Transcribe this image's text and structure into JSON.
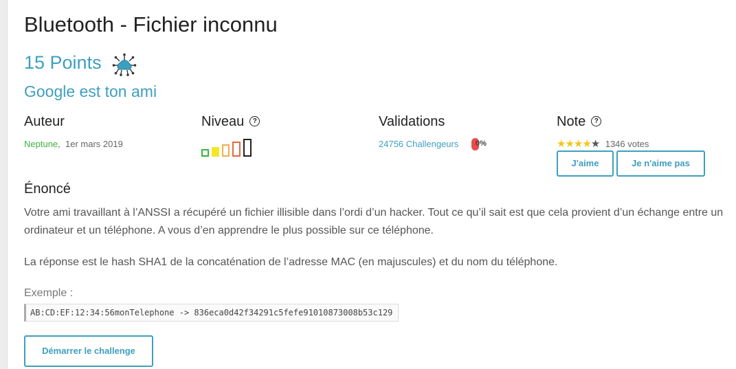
{
  "challenge": {
    "title": "Bluetooth - Fichier inconnu",
    "points": "15 Points",
    "category_icon": "network-cloud-icon",
    "hint": "Google est ton ami"
  },
  "author": {
    "heading": "Auteur",
    "name": "Neptune",
    "separator": ",",
    "date": "1er mars 2019"
  },
  "level": {
    "heading": "Niveau",
    "help_glyph": "?",
    "current": 1,
    "max": 5,
    "colors": [
      "#3bb33b",
      "#f5e625",
      "#f0ad4e",
      "#e8663c",
      "#222222"
    ]
  },
  "validations": {
    "heading": "Validations",
    "count": "24756 Challengeurs",
    "percent_text": "0%",
    "badge_color": "#e84c4c"
  },
  "rating": {
    "heading": "Note",
    "help_glyph": "?",
    "stars": 4,
    "max_stars": 5,
    "votes": "1346 votes",
    "like": "J'aime",
    "dislike": "Je n'aime pas"
  },
  "statement": {
    "heading": "Énoncé",
    "para1": "Votre ami travaillant à l’ANSSI a récupéré un fichier illisible dans l’ordi d’un hacker. Tout ce qu’il sait est que cela provient d’un échange entre un ordinateur et un téléphone. A vous d’en apprendre le plus possible sur ce téléphone.",
    "para2": "La réponse est le hash SHA1 de la concaténation de l’adresse MAC (en majuscules) et du nom du téléphone.",
    "example_label": "Exemple :",
    "example_code": "AB:CD:EF:12:34:56monTelephone -> 836eca0d42f34291c5fefe91010873008b53c129"
  },
  "start_button": "Démarrer le challenge",
  "colors": {
    "accent": "#3d9fbf",
    "author_link": "#3bb33b"
  }
}
